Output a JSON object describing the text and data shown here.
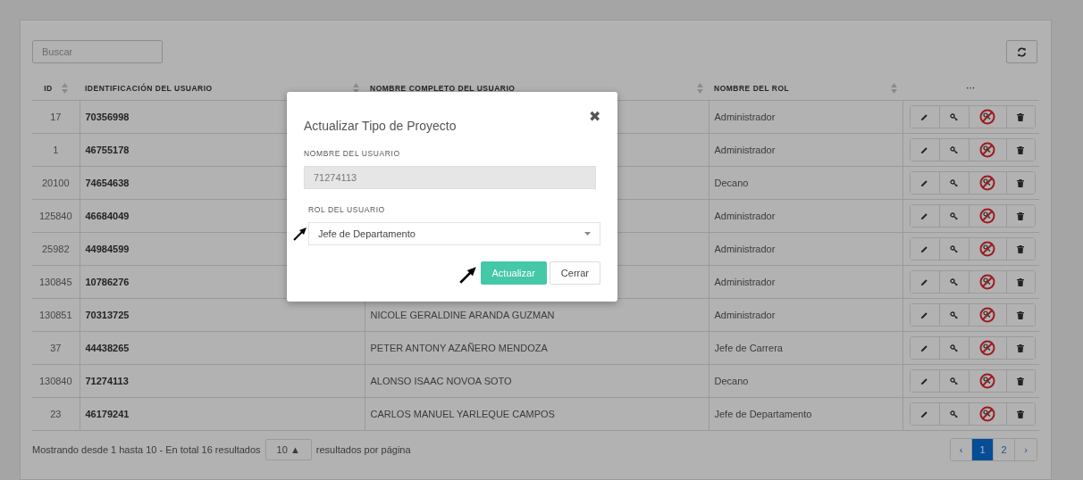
{
  "search": {
    "placeholder": "Buscar"
  },
  "table": {
    "columns": [
      {
        "label": "ID",
        "kind": "id"
      },
      {
        "label": "IDENTIFICACIÓN DEL USUARIO",
        "kind": "ident"
      },
      {
        "label": "NOMBRE COMPLETO DEL USUARIO",
        "kind": "text"
      },
      {
        "label": "NOMBRE DEL ROL",
        "kind": "text"
      },
      {
        "label": "···",
        "kind": "actions"
      }
    ],
    "rows": [
      {
        "id": "17",
        "identification": "70356998",
        "role": "Administrador"
      },
      {
        "id": "1",
        "identification": "46755178",
        "role": "Administrador"
      },
      {
        "id": "20100",
        "identification": "74654638",
        "role": "Decano"
      },
      {
        "id": "125840",
        "identification": "46684049",
        "role": "Administrador"
      },
      {
        "id": "25982",
        "identification": "44984599",
        "role": "Administrador"
      },
      {
        "id": "130845",
        "identification": "10786276",
        "role": "Administrador"
      },
      {
        "id": "130851",
        "identification": "70313725",
        "full_name": "NICOLE GERALDINE ARANDA GUZMAN",
        "role": "Administrador"
      },
      {
        "id": "37",
        "identification": "44438265",
        "full_name": "PETER ANTONY AZAÑERO MENDOZA",
        "role": "Jefe de Carrera"
      },
      {
        "id": "130840",
        "identification": "71274113",
        "full_name": "ALONSO ISAAC NOVOA SOTO",
        "role": "Decano"
      },
      {
        "id": "23",
        "identification": "46179241",
        "full_name": "CARLOS MANUEL YARLEQUE CAMPOS",
        "role": "Jefe de Departamento"
      }
    ]
  },
  "footer": {
    "summary": "Mostrando desde 1 hasta 10 - En total 16 resultados",
    "page_size": "10 ▲",
    "page_size_suffix": "resultados por página",
    "pages": [
      {
        "label": "‹",
        "selected": false
      },
      {
        "label": "1",
        "selected": true
      },
      {
        "label": "2",
        "selected": false
      },
      {
        "label": "›",
        "selected": false
      }
    ]
  },
  "modal": {
    "title": "Actualizar Tipo de Proyecto",
    "close": "✖",
    "user_label": "NOMBRE DEL USUARIO",
    "user_value": "71274113",
    "role_label": "ROL DEL USUARIO",
    "role_value": "Jefe de Departamento",
    "buttons": [
      {
        "label": "Actualizar",
        "kind": "primary"
      },
      {
        "label": "Cerrar",
        "kind": "default"
      }
    ]
  }
}
